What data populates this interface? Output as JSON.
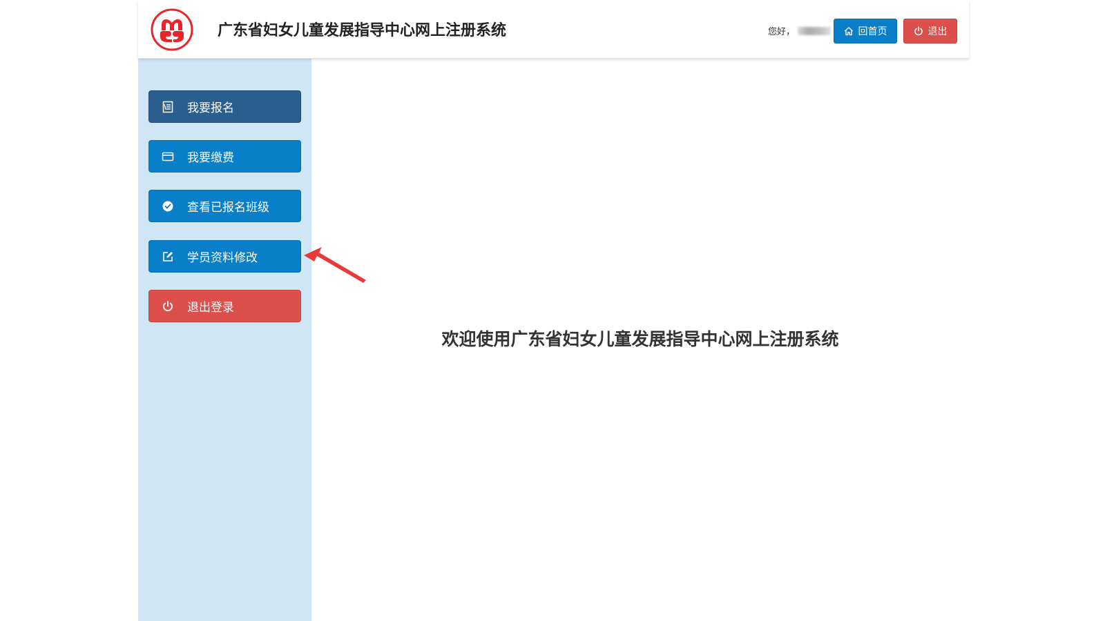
{
  "header": {
    "title": "广东省妇女儿童发展指导中心网上注册系统",
    "greeting": "您好，",
    "home_label": "回首页",
    "logout_label": "退出",
    "logo_color": "#e8262a"
  },
  "sidebar": {
    "items": [
      {
        "label": "我要报名",
        "icon": "signup-icon"
      },
      {
        "label": "我要缴费",
        "icon": "card-icon"
      },
      {
        "label": "查看已报名班级",
        "icon": "check-circle-icon"
      },
      {
        "label": "学员资料修改",
        "icon": "edit-icon"
      },
      {
        "label": "退出登录",
        "icon": "power-icon"
      }
    ]
  },
  "main": {
    "welcome": "欢迎使用广东省妇女儿童发展指导中心网上注册系统"
  },
  "colors": {
    "primary": "#0a7fc9",
    "active": "#2a5e8e",
    "danger": "#dc4f4b",
    "sidebar_bg": "#cfe6f6",
    "annotation_arrow": "#e83a3a"
  }
}
